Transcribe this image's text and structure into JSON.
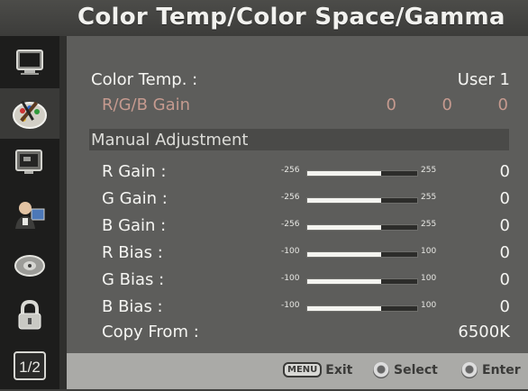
{
  "header": {
    "title": "Color Temp/Color Space/Gamma"
  },
  "sidebar": {
    "items": [
      {
        "name": "monitor-icon"
      },
      {
        "name": "palette-icon",
        "active": true
      },
      {
        "name": "screen-icon"
      },
      {
        "name": "user-icon"
      },
      {
        "name": "disc-icon"
      },
      {
        "name": "lock-icon"
      },
      {
        "name": "page-indicator",
        "label": "1/2"
      }
    ]
  },
  "main": {
    "color_temp": {
      "label": "Color Temp. :",
      "value": "User 1"
    },
    "rgb_gain": {
      "label": "R/G/B Gain",
      "r": "0",
      "g": "0",
      "b": "0"
    },
    "section_title": "Manual Adjustment",
    "sliders": [
      {
        "label": "R Gain :",
        "min": "-256",
        "max": "255",
        "value": "0",
        "level": 0.67
      },
      {
        "label": "G Gain :",
        "min": "-256",
        "max": "255",
        "value": "0",
        "level": 0.67
      },
      {
        "label": "B Gain :",
        "min": "-256",
        "max": "255",
        "value": "0",
        "level": 0.67
      },
      {
        "label": "R Bias :",
        "min": "-100",
        "max": "100",
        "value": "0",
        "level": 0.67
      },
      {
        "label": "G Bias :",
        "min": "-100",
        "max": "100",
        "value": "0",
        "level": 0.67
      },
      {
        "label": "B Bias :",
        "min": "-100",
        "max": "100",
        "value": "0",
        "level": 0.67
      }
    ],
    "copy_from": {
      "label": "Copy From :",
      "value": "6500K"
    }
  },
  "footer": {
    "menu_key": "MENU",
    "exit": "Exit",
    "select": "Select",
    "enter": "Enter"
  },
  "colors": {
    "background": "#5d5d5b",
    "sidebar": "#1d1d1c",
    "disabled_text": "#c59a8f",
    "footer": "#aaaaa7"
  }
}
